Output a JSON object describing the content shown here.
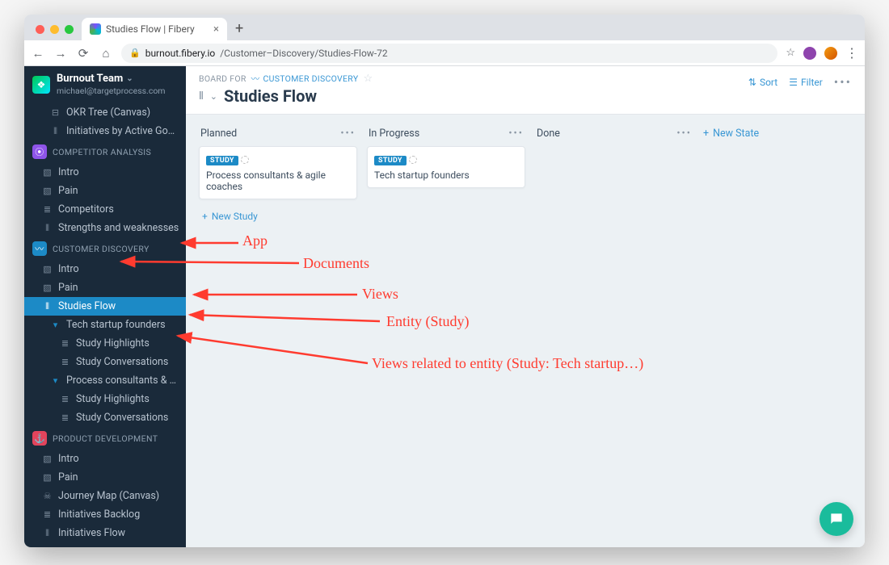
{
  "browser": {
    "tab_title": "Studies Flow | Fibery",
    "url_host": "burnout.fibery.io",
    "url_path": "/Customer–Discovery/Studies-Flow-72"
  },
  "workspace": {
    "name": "Burnout Team",
    "email": "michael@targetprocess.com"
  },
  "sidebar": {
    "truncated_top": [
      {
        "icon": "▸",
        "label": "OKR Tree (Canvas)"
      },
      {
        "icon": "⦀",
        "label": "Initiatives by Active Goals"
      }
    ],
    "sections": [
      {
        "badge_color": "#8e54e9",
        "title": "COMPETITOR ANALYSIS",
        "items": [
          {
            "icon": "doc",
            "label": "Intro"
          },
          {
            "icon": "doc",
            "label": "Pain"
          },
          {
            "icon": "list",
            "label": "Competitors"
          },
          {
            "icon": "board",
            "label": "Strengths and weaknesses"
          }
        ]
      },
      {
        "badge_color": "#1c8ac6",
        "title": "CUSTOMER DISCOVERY",
        "items": [
          {
            "icon": "doc",
            "label": "Intro"
          },
          {
            "icon": "doc",
            "label": "Pain"
          },
          {
            "icon": "board",
            "label": "Studies Flow",
            "selected": true
          },
          {
            "icon": "caret",
            "label": "Tech startup founders",
            "children": [
              {
                "icon": "list",
                "label": "Study Highlights"
              },
              {
                "icon": "list",
                "label": "Study Conversations"
              }
            ]
          },
          {
            "icon": "caret",
            "label": "Process consultants & agile c…",
            "children": [
              {
                "icon": "list",
                "label": "Study Highlights"
              },
              {
                "icon": "list",
                "label": "Study Conversations"
              }
            ]
          }
        ]
      },
      {
        "badge_color": "#e2445c",
        "title": "PRODUCT DEVELOPMENT",
        "items": [
          {
            "icon": "doc",
            "label": "Intro"
          },
          {
            "icon": "doc",
            "label": "Pain"
          },
          {
            "icon": "skull",
            "label": "Journey Map (Canvas)"
          },
          {
            "icon": "list",
            "label": "Initiatives Backlog"
          },
          {
            "icon": "board",
            "label": "Initiatives Flow"
          }
        ]
      }
    ]
  },
  "main": {
    "breadcrumb_prefix": "BOARD FOR",
    "breadcrumb_link": "CUSTOMER DISCOVERY",
    "title": "Studies Flow",
    "actions": {
      "sort": "Sort",
      "filter": "Filter"
    }
  },
  "board": {
    "columns": [
      {
        "title": "Planned",
        "cards": [
          {
            "badge": "STUDY",
            "title": "Process consultants & agile coaches"
          }
        ],
        "new_label": "New Study"
      },
      {
        "title": "In Progress",
        "cards": [
          {
            "badge": "STUDY",
            "title": "Tech startup founders"
          }
        ]
      },
      {
        "title": "Done",
        "cards": []
      }
    ],
    "new_state": "New State"
  },
  "annotations": {
    "app": "App",
    "documents": "Documents",
    "views": "Views",
    "entity": "Entity (Study)",
    "related": "Views related to entity (Study: Tech startup…)"
  }
}
